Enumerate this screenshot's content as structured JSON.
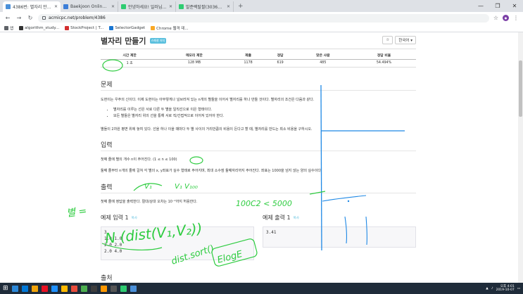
{
  "browser": {
    "tabs": [
      {
        "label": "4386번: 별자리 만들기",
        "color": "#4a90d9",
        "active": true
      },
      {
        "label": "Baekjoon Online Judge",
        "color": "#3b7dd8",
        "active": false
      },
      {
        "label": "안녕하세요! 일러님 캐스터",
        "color": "#2ecc71",
        "active": false
      },
      {
        "label": "발준렉탈팔(30363) : 네이버",
        "color": "#2ecc71",
        "active": false
      }
    ],
    "new_tab": "+",
    "window_controls": [
      "—",
      "❐",
      "✕"
    ],
    "url": "acmicpc.net/problem/4386",
    "bookmarks": [
      {
        "label": "앱",
        "color": "#5f6368"
      },
      {
        "label": "algorithm_study...",
        "color": "#333333"
      },
      {
        "label": "StockProject | T...",
        "color": "#d32f2f"
      },
      {
        "label": "SelectorGadget",
        "color": "#1976d2"
      },
      {
        "label": "Chrome 웹격 데...",
        "color": "#f9a825"
      }
    ]
  },
  "problem": {
    "title": "별자리 만들기",
    "tag": "스페셜 저지",
    "star_button": "☆",
    "lang_button": "한국어 ▾",
    "info_headers": [
      "시간 제한",
      "메모리 제한",
      "제출",
      "정답",
      "맞은 사람",
      "정답 비율"
    ],
    "info_values": [
      "1 초",
      "128 MB",
      "1178",
      "619",
      "485",
      "54.494%"
    ],
    "section_problem": "문제",
    "problem_text1": "도현이는 우주의 신이다. 이제 도현이는 아무렇게나 널브러져 있는 n개의 별들을 이어서 별자리를 하나 만들 것이다. 별자리의 조건은 다음과 같다.",
    "bullets": [
      "별자리를 이루는 선은 서로 다른 두 별을 일직선으로 이은 형태이다.",
      "모든 별들은 별자리 위의 선을 통해 서로 직/간접적으로 이어져 있어야 한다."
    ],
    "problem_text2": "별들이 2차원 평면 위에 놓여 있다. 선을 하나 이을 때마다 두 별 사이의 거리만큼의 비용이 든다고 할 때, 별자리를 만드는 최소 비용을 구하시오.",
    "section_input": "입력",
    "input_text1": "첫째 줄에 별의 개수 n이 주어진다. (1 ≤ n ≤ 100)",
    "input_text2": "둘째 줄부터 n개의 줄에 걸쳐 각 별의 x, y좌표가 실수 형태로 주어지며, 최대 소수점 둘째자리까지 주어진다. 좌표는 1000을 넘지 않는 양의 실수이다.",
    "section_output": "출력",
    "output_text": "첫째 줄에 정답을 출력한다. 절대/상대 오차는 10⁻²까지 허용한다.",
    "sample_input_title": "예제 입력 1",
    "sample_output_title": "예제 출력 1",
    "copy_label": "복사",
    "sample_input": "3\n1.0 1.0\n2.0 2.0\n2.0 4.0",
    "sample_output": "3.41",
    "section_source": "출처"
  },
  "handwriting": {
    "v1": "V₁",
    "v100": "V₁ V₁₀₀",
    "combo": "100C2 < 5000",
    "star_label": "별 =",
    "formula": "N (dist(V₁,V₂))",
    "sort": "dist.sort()",
    "elog": "ElogE"
  },
  "taskbar": {
    "apps": [
      "#2b88d8",
      "#0078d7",
      "#f0a30a",
      "#e81123",
      "#1e90ff",
      "#ffb900",
      "#e74c3c",
      "#4caf50",
      "#3d3d3d",
      "#ff9800",
      "#555555",
      "#2ecc71",
      "#4a90d9"
    ],
    "time": "오후 4:01",
    "date": "2019-10-07"
  },
  "colors": {
    "ink_green": "#2ecc40",
    "ink_blue": "#1e88e5",
    "accent": "#5bc0de"
  }
}
